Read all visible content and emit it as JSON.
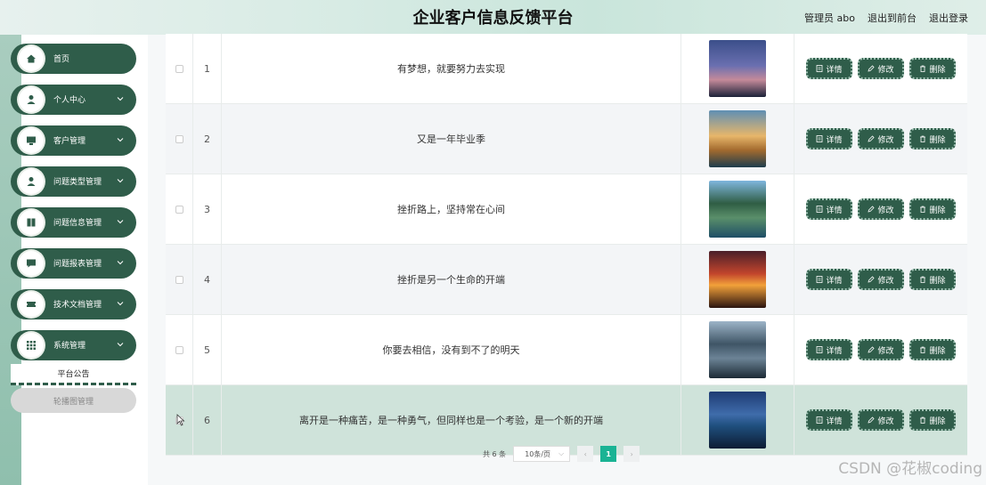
{
  "header": {
    "title": "企业客户信息反馈平台",
    "user": "管理员 abo",
    "to_front": "退出到前台",
    "logout": "退出登录"
  },
  "sidebar": {
    "items": [
      {
        "label": "首页",
        "icon": "home-icon",
        "expandable": false
      },
      {
        "label": "个人中心",
        "icon": "user-icon",
        "expandable": true
      },
      {
        "label": "客户管理",
        "icon": "monitor-icon",
        "expandable": true
      },
      {
        "label": "问题类型管理",
        "icon": "user-icon",
        "expandable": true
      },
      {
        "label": "问题信息管理",
        "icon": "book-icon",
        "expandable": true
      },
      {
        "label": "问题报表管理",
        "icon": "chat-icon",
        "expandable": true
      },
      {
        "label": "技术文档管理",
        "icon": "ticket-icon",
        "expandable": true
      },
      {
        "label": "系统管理",
        "icon": "grid-icon",
        "expandable": true
      }
    ],
    "sub_active": "平台公告",
    "sub_item": "轮播图管理"
  },
  "table": {
    "rows": [
      {
        "num": "1",
        "text": "有梦想，就要努力去实现",
        "img": "pier-dusk"
      },
      {
        "num": "2",
        "text": "又是一年毕业季",
        "img": "boats-sunset"
      },
      {
        "num": "3",
        "text": "挫折路上，坚持常在心间",
        "img": "karst-river"
      },
      {
        "num": "4",
        "text": "挫折是另一个生命的开端",
        "img": "tree-sunset"
      },
      {
        "num": "5",
        "text": "你要去相信，没有到不了的明天",
        "img": "mountain-stream"
      },
      {
        "num": "6",
        "text": "离开是一种痛苦，是一种勇气，但同样也是一个考验，是一个新的开端",
        "img": "lake-night"
      }
    ],
    "actions": {
      "detail": "详情",
      "edit": "修改",
      "delete": "删除"
    },
    "selected_row": 6
  },
  "pager": {
    "total": "共 6 条",
    "page_size": "10条/页",
    "current_page": "1"
  },
  "watermark": "CSDN @花椒coding"
}
